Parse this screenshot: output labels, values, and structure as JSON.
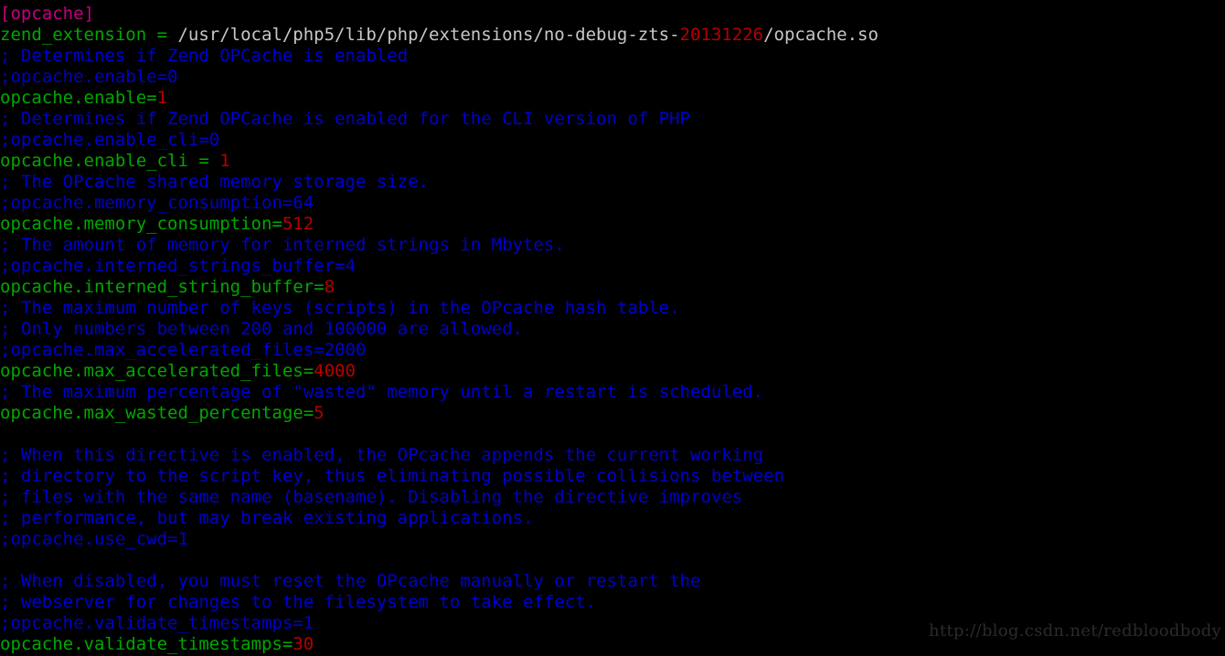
{
  "window": {
    "title": "php.ini",
    "background_color": "#000000"
  },
  "colors": {
    "section": "#c5007f",
    "comment": "#0000cf",
    "key": "#00a800",
    "value": "#b50000",
    "path": "#c8c8c8",
    "watermark": "#2b2b2b",
    "background": "#000000"
  },
  "watermark": {
    "text": "http://blog.csdn.net/redbloodbody"
  },
  "editor": {
    "language": "ini",
    "file_section": "[opcache]",
    "lines": [
      {
        "type": "section",
        "tokens": [
          {
            "kind": "section",
            "text": "[opcache]"
          }
        ]
      },
      {
        "type": "setting",
        "tokens": [
          {
            "kind": "key",
            "text": "zend_extension = "
          },
          {
            "kind": "path",
            "text": "/usr/local/php5/lib/php/extensions/no-debug-zts-"
          },
          {
            "kind": "value",
            "text": "20131226"
          },
          {
            "kind": "path",
            "text": "/opcache.so"
          }
        ]
      },
      {
        "type": "comment",
        "tokens": [
          {
            "kind": "comment",
            "text": "; Determines if Zend OPCache is enabled"
          }
        ]
      },
      {
        "type": "comment",
        "tokens": [
          {
            "kind": "comment",
            "text": ";opcache.enable=0"
          }
        ]
      },
      {
        "type": "setting",
        "tokens": [
          {
            "kind": "key",
            "text": "opcache.enable="
          },
          {
            "kind": "value",
            "text": "1"
          }
        ]
      },
      {
        "type": "comment",
        "tokens": [
          {
            "kind": "comment",
            "text": "; Determines if Zend OPCache is enabled for the CLI version of PHP"
          }
        ]
      },
      {
        "type": "comment",
        "tokens": [
          {
            "kind": "comment",
            "text": ";opcache.enable_cli=0"
          }
        ]
      },
      {
        "type": "setting",
        "tokens": [
          {
            "kind": "key",
            "text": "opcache.enable_cli = "
          },
          {
            "kind": "value",
            "text": "1"
          }
        ]
      },
      {
        "type": "comment",
        "tokens": [
          {
            "kind": "comment",
            "text": "; The OPcache shared memory storage size."
          }
        ]
      },
      {
        "type": "comment",
        "tokens": [
          {
            "kind": "comment",
            "text": ";opcache.memory_consumption=64"
          }
        ]
      },
      {
        "type": "setting",
        "tokens": [
          {
            "kind": "key",
            "text": "opcache.memory_consumption="
          },
          {
            "kind": "value",
            "text": "512"
          }
        ]
      },
      {
        "type": "comment",
        "tokens": [
          {
            "kind": "comment",
            "text": "; The amount of memory for interned strings in Mbytes."
          }
        ]
      },
      {
        "type": "comment",
        "tokens": [
          {
            "kind": "comment",
            "text": ";opcache.interned_strings_buffer=4"
          }
        ]
      },
      {
        "type": "setting",
        "tokens": [
          {
            "kind": "key",
            "text": "opcache.interned_string_buffer="
          },
          {
            "kind": "value",
            "text": "8"
          }
        ]
      },
      {
        "type": "comment",
        "tokens": [
          {
            "kind": "comment",
            "text": "; The maximum number of keys (scripts) in the OPcache hash table."
          }
        ]
      },
      {
        "type": "comment",
        "tokens": [
          {
            "kind": "comment",
            "text": "; Only numbers between 200 and 100000 are allowed."
          }
        ]
      },
      {
        "type": "comment",
        "tokens": [
          {
            "kind": "comment",
            "text": ";opcache.max_accelerated_files=2000"
          }
        ]
      },
      {
        "type": "setting",
        "tokens": [
          {
            "kind": "key",
            "text": "opcache.max_accelerated_files="
          },
          {
            "kind": "value",
            "text": "4000"
          }
        ]
      },
      {
        "type": "comment",
        "tokens": [
          {
            "kind": "comment",
            "text": "; The maximum percentage of \"wasted\" memory until a restart is scheduled."
          }
        ]
      },
      {
        "type": "setting",
        "tokens": [
          {
            "kind": "key",
            "text": "opcache.max_wasted_percentage="
          },
          {
            "kind": "value",
            "text": "5"
          }
        ]
      },
      {
        "type": "blank",
        "tokens": [
          {
            "kind": "blank",
            "text": " "
          }
        ]
      },
      {
        "type": "comment",
        "tokens": [
          {
            "kind": "comment",
            "text": "; When this directive is enabled, the OPcache appends the current working"
          }
        ]
      },
      {
        "type": "comment",
        "tokens": [
          {
            "kind": "comment",
            "text": "; directory to the script key, thus eliminating possible collisions between"
          }
        ]
      },
      {
        "type": "comment",
        "tokens": [
          {
            "kind": "comment",
            "text": "; files with the same name (basename). Disabling the directive improves"
          }
        ]
      },
      {
        "type": "comment",
        "tokens": [
          {
            "kind": "comment",
            "text": "; performance, but may break existing applications."
          }
        ]
      },
      {
        "type": "comment",
        "tokens": [
          {
            "kind": "comment",
            "text": ";opcache.use_cwd=1"
          }
        ]
      },
      {
        "type": "blank",
        "tokens": [
          {
            "kind": "blank",
            "text": " "
          }
        ]
      },
      {
        "type": "comment",
        "tokens": [
          {
            "kind": "comment",
            "text": "; When disabled, you must reset the OPcache manually or restart the"
          }
        ]
      },
      {
        "type": "comment",
        "tokens": [
          {
            "kind": "comment",
            "text": "; webserver for changes to the filesystem to take effect."
          }
        ]
      },
      {
        "type": "comment",
        "tokens": [
          {
            "kind": "comment",
            "text": ";opcache.validate_timestamps=1"
          }
        ]
      },
      {
        "type": "setting",
        "tokens": [
          {
            "kind": "key",
            "text": "opcache.validate_timestamps="
          },
          {
            "kind": "value",
            "text": "30"
          }
        ]
      }
    ]
  }
}
